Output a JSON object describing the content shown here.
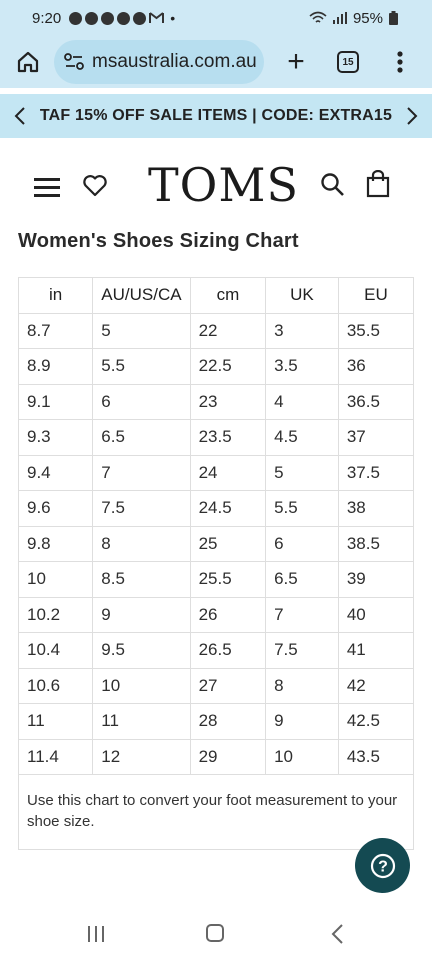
{
  "status": {
    "time": "9:20",
    "battery": "95%"
  },
  "browser": {
    "url": "msaustralia.com.au",
    "tab_count": "15",
    "new_tab_label": "+"
  },
  "promo": {
    "text": "TAF 15% OFF SALE ITEMS | CODE: EXTRA15"
  },
  "header": {
    "logo": "TOMS"
  },
  "page": {
    "title": "Women's Shoes Sizing Chart",
    "note": "Use this chart to convert your foot measurement to your shoe size."
  },
  "table": {
    "headers": [
      "in",
      "AU/US/CA",
      "cm",
      "UK",
      "EU"
    ],
    "rows": [
      [
        "8.7",
        "5",
        "22",
        "3",
        "35.5"
      ],
      [
        "8.9",
        "5.5",
        "22.5",
        "3.5",
        "36"
      ],
      [
        "9.1",
        "6",
        "23",
        "4",
        "36.5"
      ],
      [
        "9.3",
        "6.5",
        "23.5",
        "4.5",
        "37"
      ],
      [
        "9.4",
        "7",
        "24",
        "5",
        "37.5"
      ],
      [
        "9.6",
        "7.5",
        "24.5",
        "5.5",
        "38"
      ],
      [
        "9.8",
        "8",
        "25",
        "6",
        "38.5"
      ],
      [
        "10",
        "8.5",
        "25.5",
        "6.5",
        "39"
      ],
      [
        "10.2",
        "9",
        "26",
        "7",
        "40"
      ],
      [
        "10.4",
        "9.5",
        "26.5",
        "7.5",
        "41"
      ],
      [
        "10.6",
        "10",
        "27",
        "8",
        "42"
      ],
      [
        "11",
        "11",
        "28",
        "9",
        "42.5"
      ],
      [
        "11.4",
        "12",
        "29",
        "10",
        "43.5"
      ]
    ]
  },
  "help": {
    "label": "?"
  }
}
